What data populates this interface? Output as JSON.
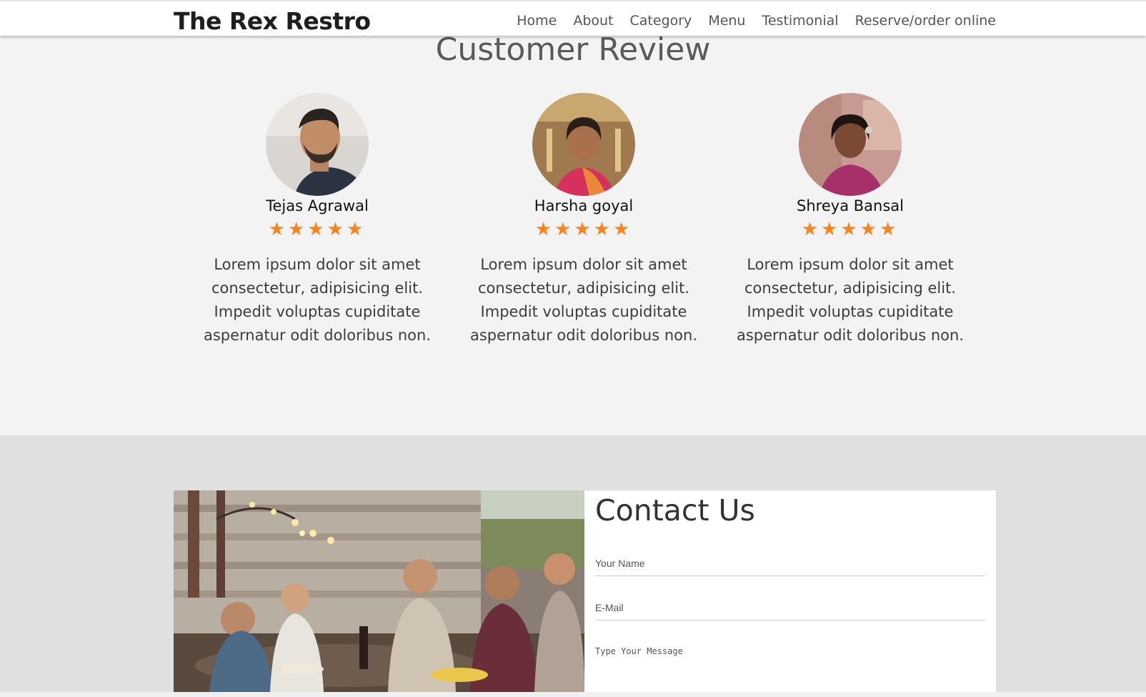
{
  "brand": "The Rex Restro",
  "nav": [
    "Home",
    "About",
    "Category",
    "Menu",
    "Testimonial",
    "Reserve/order online"
  ],
  "reviews": {
    "title": "Customer Review",
    "items": [
      {
        "name": "Tejas Agrawal",
        "stars": "★★★★★",
        "rating": 5,
        "text": "Lorem ipsum dolor sit amet consectetur, adipisicing elit. Impedit voluptas cupiditate aspernatur odit doloribus non."
      },
      {
        "name": "Harsha goyal",
        "stars": "★★★★★",
        "rating": 5,
        "text": "Lorem ipsum dolor sit amet consectetur, adipisicing elit. Impedit voluptas cupiditate aspernatur odit doloribus non."
      },
      {
        "name": "Shreya Bansal",
        "stars": "★★★★★",
        "rating": 5,
        "text": "Lorem ipsum dolor sit amet consectetur, adipisicing elit. Impedit voluptas cupiditate aspernatur odit doloribus non."
      }
    ]
  },
  "contact": {
    "title": "Contact Us",
    "name_placeholder": "Your Name",
    "email_placeholder": "E-Mail",
    "message_placeholder": "Type Your Message"
  },
  "colors": {
    "star": "#f7851f",
    "section_bg": "#f3f3f3",
    "page_bg": "#e0e0e0"
  }
}
